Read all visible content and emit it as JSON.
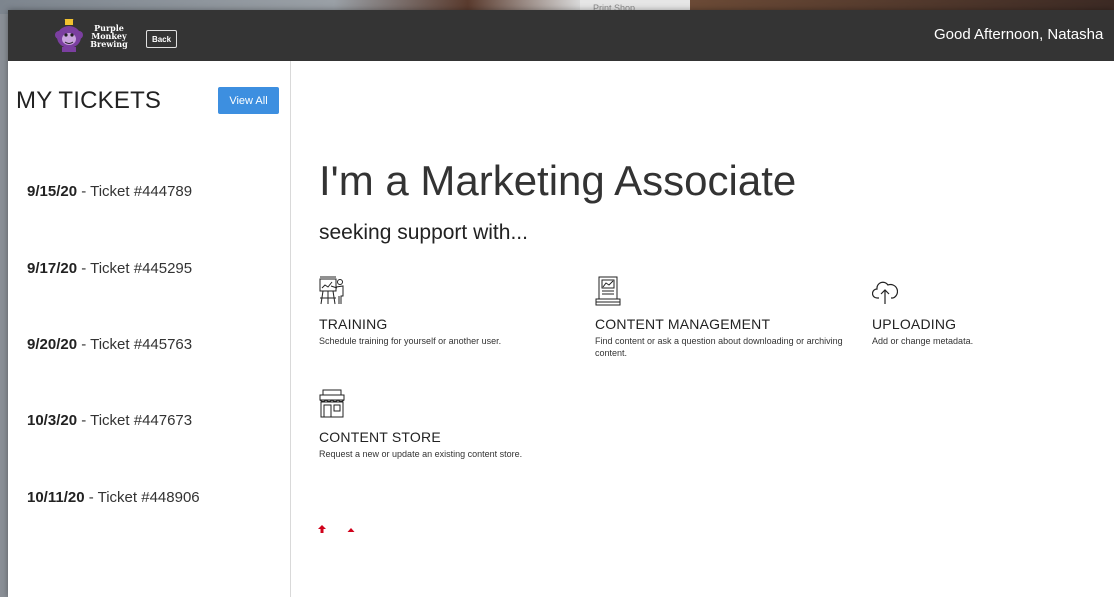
{
  "background": {
    "peek_text": "Print Shop"
  },
  "header": {
    "logo_text": [
      "Purple",
      "Monkey",
      "Brewing"
    ],
    "back_label": "Back",
    "greeting": "Good Afternoon, Natasha"
  },
  "sidebar": {
    "title": "MY TICKETS",
    "view_all_label": "View All",
    "tickets": [
      {
        "date": "9/15/20",
        "label": " - Ticket #444789"
      },
      {
        "date": "9/17/20",
        "label": " - Ticket #445295"
      },
      {
        "date": "9/20/20",
        "label": " - Ticket #445763"
      },
      {
        "date": "10/3/20",
        "label": " - Ticket #447673"
      },
      {
        "date": "10/11/20",
        "label": " - Ticket #448906"
      }
    ]
  },
  "main": {
    "headline": "I'm a Marketing Associate",
    "subheadline": "seeking support with...",
    "options": [
      {
        "icon": "training-easel-icon",
        "title": "TRAINING",
        "description": "Schedule training for yourself or another user."
      },
      {
        "icon": "content-document-icon",
        "title": "CONTENT MANAGEMENT",
        "description": "Find content or ask a question about downloading or archiving content."
      },
      {
        "icon": "cloud-upload-icon",
        "title": "UPLOADING",
        "description": "Add or change metadata."
      },
      {
        "icon": "storefront-icon",
        "title": "CONTENT STORE",
        "description": "Request a new or update an existing content store."
      }
    ]
  },
  "colors": {
    "header_bg": "#343434",
    "accent": "#3d8fe0",
    "arrow_red": "#d0021b"
  }
}
